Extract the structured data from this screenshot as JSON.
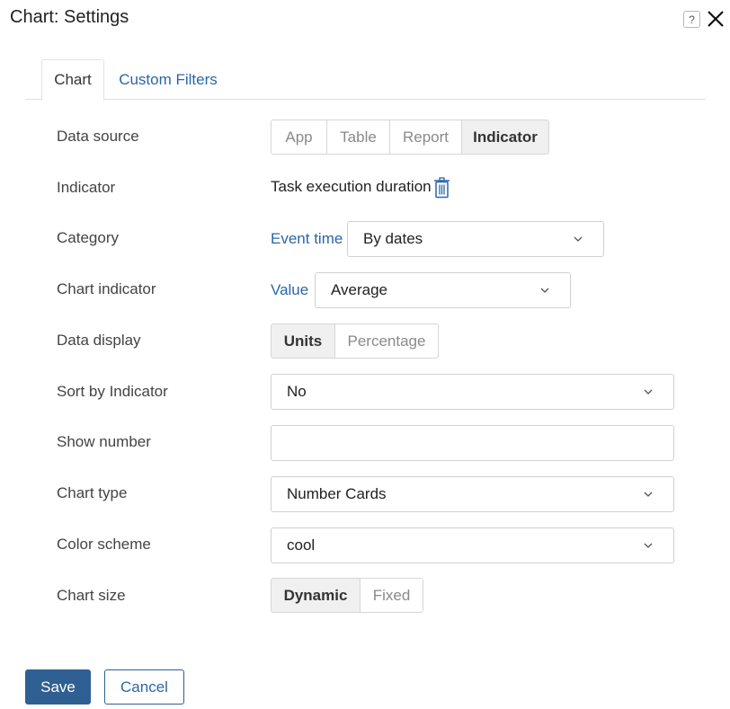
{
  "dialog": {
    "title": "Chart: Settings",
    "help_label": "?"
  },
  "tabs": [
    {
      "label": "Chart",
      "active": true
    },
    {
      "label": "Custom Filters",
      "active": false
    }
  ],
  "form": {
    "data_source": {
      "label": "Data source",
      "options": [
        "App",
        "Table",
        "Report",
        "Indicator"
      ],
      "selected": "Indicator"
    },
    "indicator": {
      "label": "Indicator",
      "value": "Task execution duration"
    },
    "category": {
      "label": "Category",
      "link": "Event time",
      "value": "By dates"
    },
    "chart_indicator": {
      "label": "Chart indicator",
      "link": "Value",
      "value": "Average"
    },
    "data_display": {
      "label": "Data display",
      "options": [
        "Units",
        "Percentage"
      ],
      "selected": "Units"
    },
    "sort_by_indicator": {
      "label": "Sort by Indicator",
      "value": "No"
    },
    "show_number": {
      "label": "Show number",
      "value": ""
    },
    "chart_type": {
      "label": "Chart type",
      "value": "Number Cards"
    },
    "color_scheme": {
      "label": "Color scheme",
      "value": "cool"
    },
    "chart_size": {
      "label": "Chart size",
      "options": [
        "Dynamic",
        "Fixed"
      ],
      "selected": "Dynamic"
    }
  },
  "actions": {
    "save_label": "Save",
    "cancel_label": "Cancel"
  },
  "colors": {
    "accent": "#2f5f93",
    "link": "#2b66a8",
    "selected_segment_bg": "#f0f0f0"
  },
  "icons": [
    "help-icon",
    "close-icon",
    "trash-icon",
    "chevron-down-icon"
  ]
}
